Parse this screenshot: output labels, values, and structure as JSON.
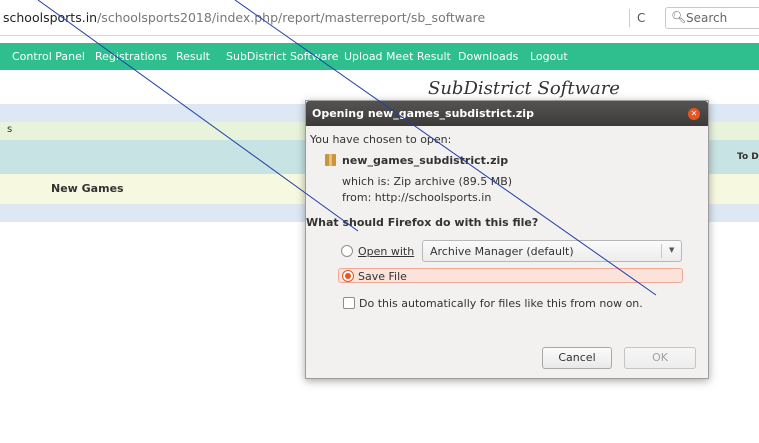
{
  "browser": {
    "url_host": "schoolsports.in",
    "url_path": "/schoolsports2018/index.php/report/masterreport/sb_software",
    "reload_glyph": "C",
    "search_placeholder": "Search"
  },
  "nav": {
    "items": [
      "Control Panel",
      "Registrations",
      "Result",
      "SubDistrict Software",
      "Upload Meet Result",
      "Downloads",
      "Logout"
    ]
  },
  "page": {
    "title": "SubDistrict Software",
    "row_label_fragment": "s",
    "header_fragment": "To D",
    "new_games_label": "New Games"
  },
  "dialog": {
    "title": "Opening new_games_subdistrict.zip",
    "intro": "You have chosen to open:",
    "file_name": "new_games_subdistrict.zip",
    "file_type": "which is: Zip archive (89.5 MB)",
    "file_from": "from: http://schoolsports.in",
    "question": "What should Firefox do with this file?",
    "open_with_label": "Open with",
    "open_with_app": "Archive Manager (default)",
    "save_file_label": "Save File",
    "auto_label": "Do this automatically for files like this from now on.",
    "cancel_label": "Cancel",
    "ok_label": "OK",
    "selected_option": "Save File"
  },
  "colors": {
    "nav_bg": "#2fbf8f",
    "accent": "#e95420",
    "annotation_line": "#1f3fa6"
  }
}
